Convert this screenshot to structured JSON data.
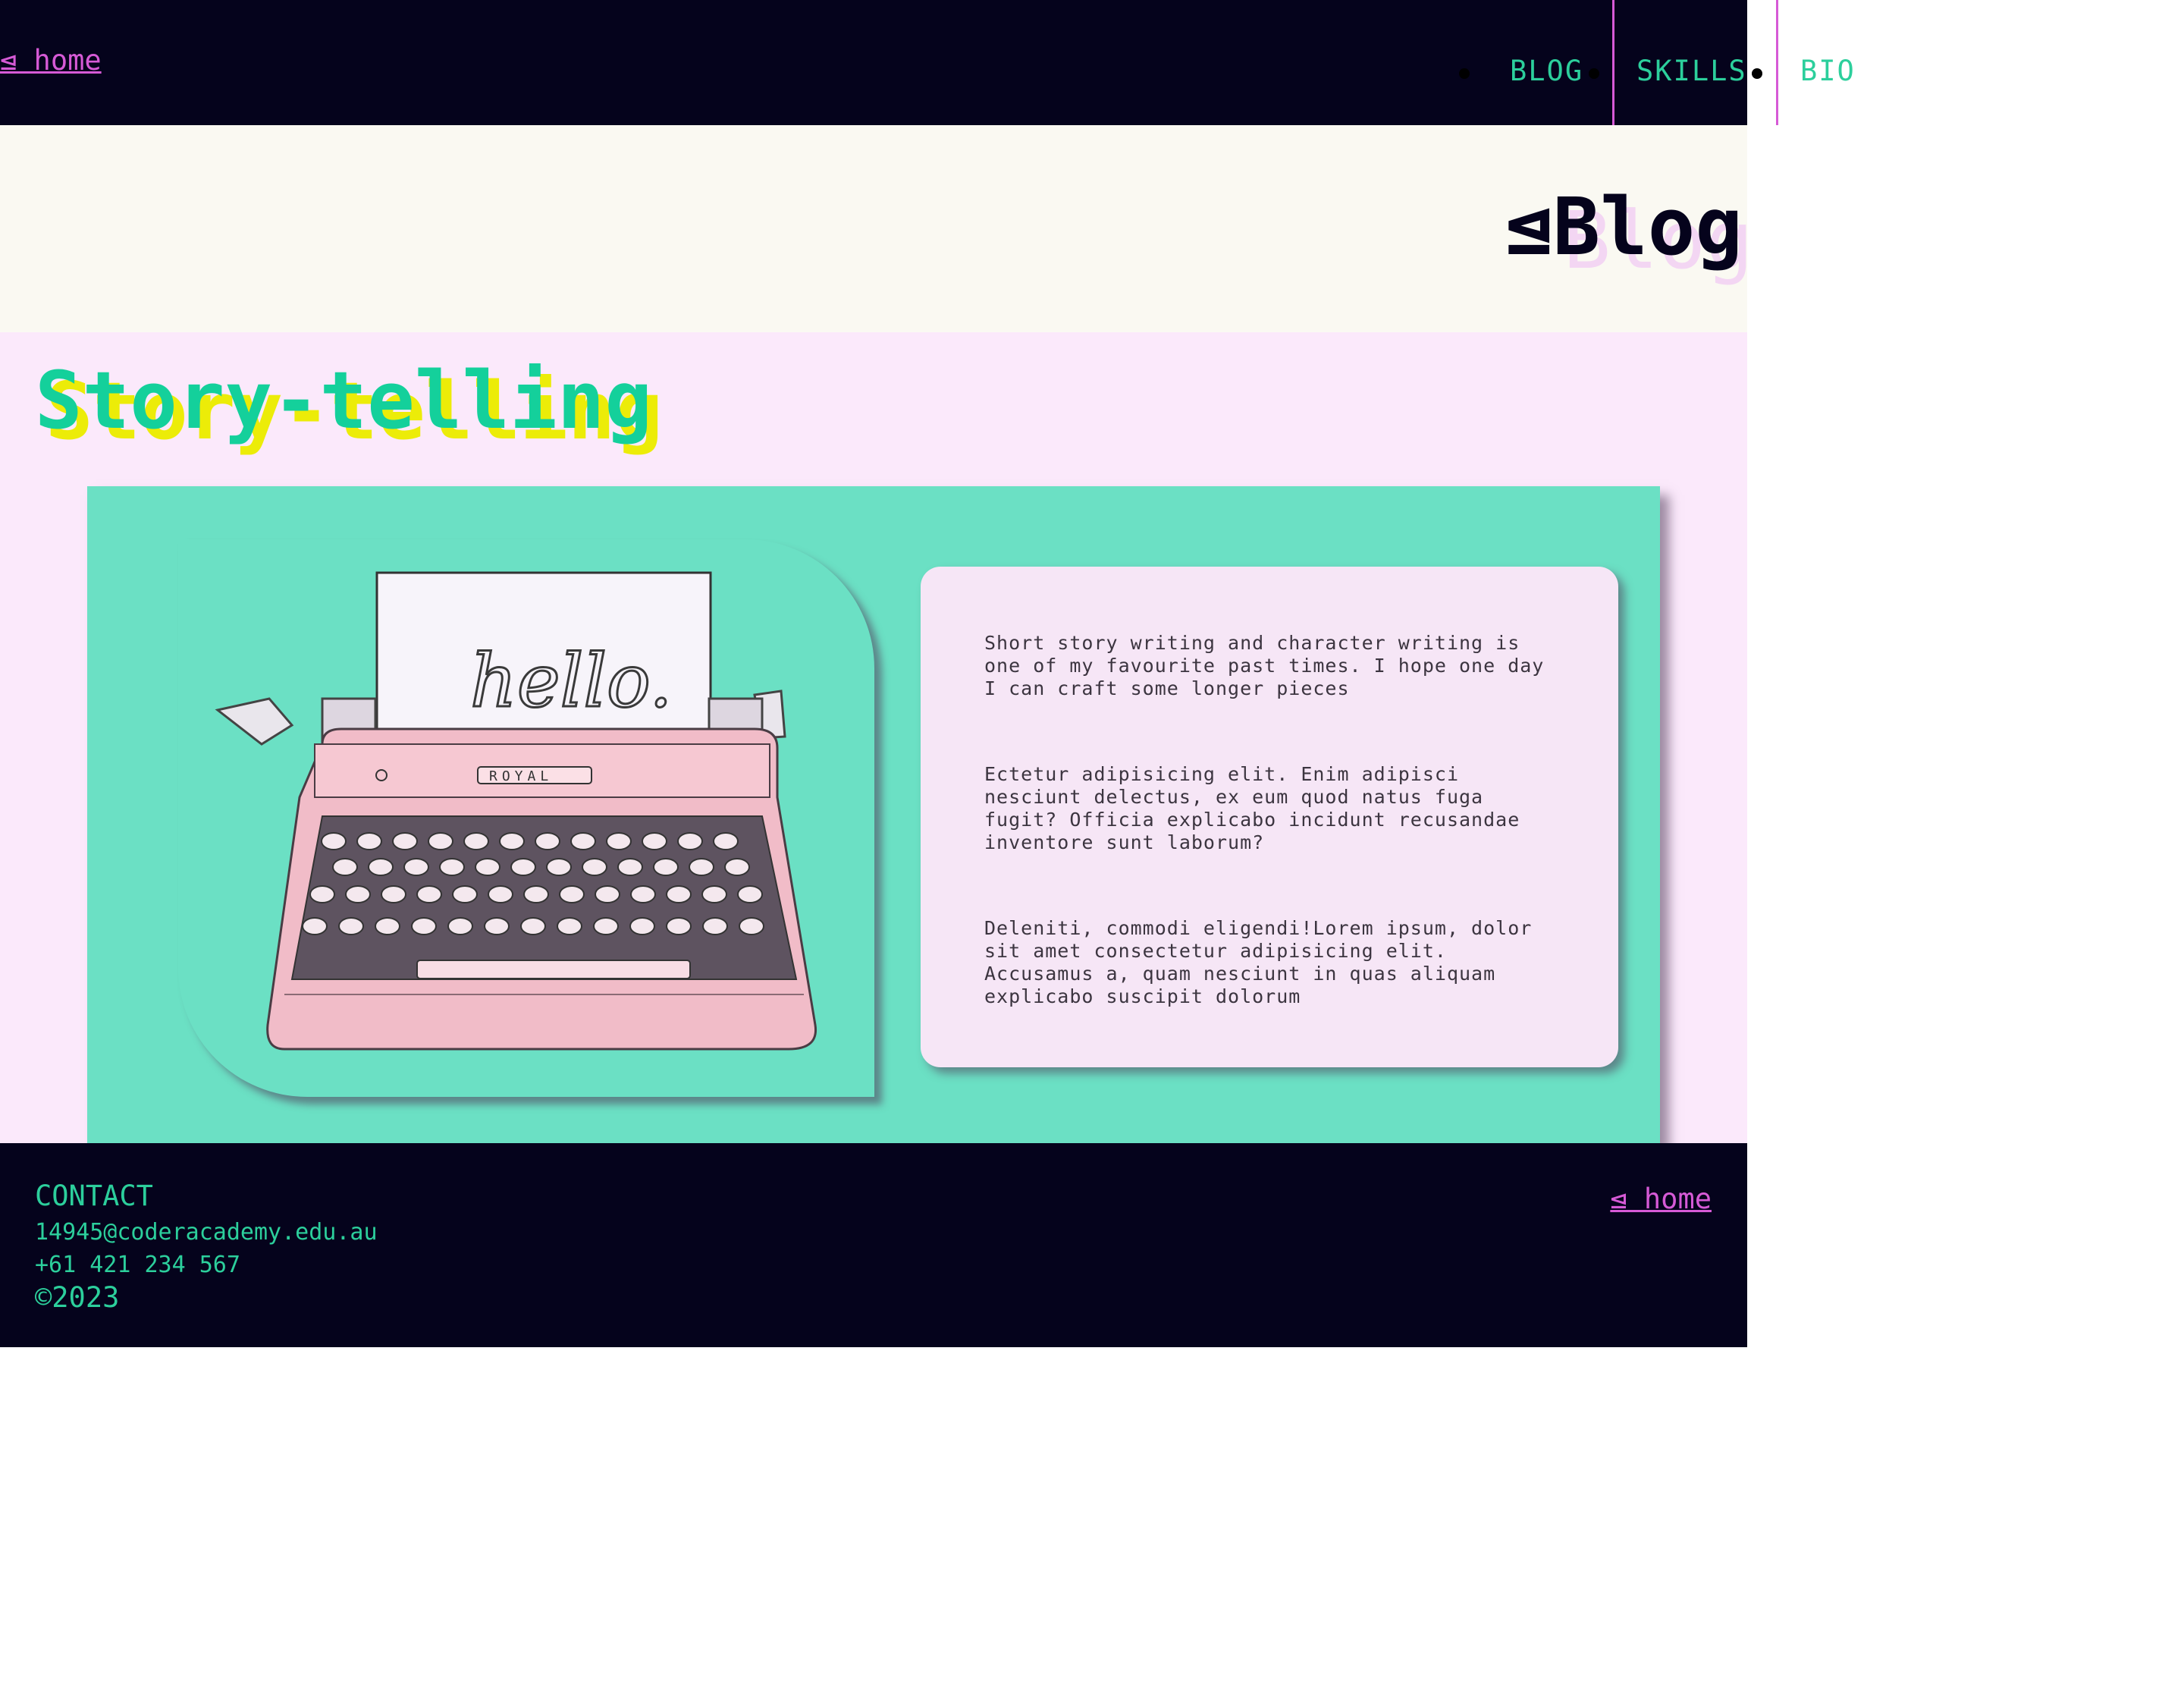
{
  "header": {
    "home_link": "⊴ home",
    "nav": [
      {
        "label": "BLOG"
      },
      {
        "label": "SKILLS"
      },
      {
        "label": "BIO"
      }
    ]
  },
  "hero": {
    "title": "⊴Blog",
    "title_shadow": "Blog"
  },
  "section": {
    "title": "Story-telling",
    "image_text": "hello.",
    "image_brand": "ROYAL",
    "paragraphs": [
      "Short story writing and character writing is one of my favourite past times. I hope one day I can craft some longer pieces",
      "Ectetur adipisicing elit. Enim adipisci nesciunt delectus, ex eum quod natus fuga fugit? Officia explicabo incidunt recusandae inventore sunt laborum?",
      "Deleniti, commodi eligendi!Lorem ipsum, dolor sit amet consectetur adipisicing elit. Accusamus a, quam nesciunt in quas aliquam explicabo suscipit dolorum"
    ]
  },
  "footer": {
    "contact_heading": "CONTACT",
    "email": "14945@coderacademy.edu.au",
    "phone": "+61 421 234 567",
    "copyright": "©2023",
    "home_link": "⊴ home"
  },
  "colors": {
    "dark": "#05031c",
    "accent_pink": "#d65ad6",
    "accent_green": "#2ccf9c",
    "mint": "#6be0c4",
    "lavender": "#fbe9fb",
    "yellow": "#ecec08"
  }
}
